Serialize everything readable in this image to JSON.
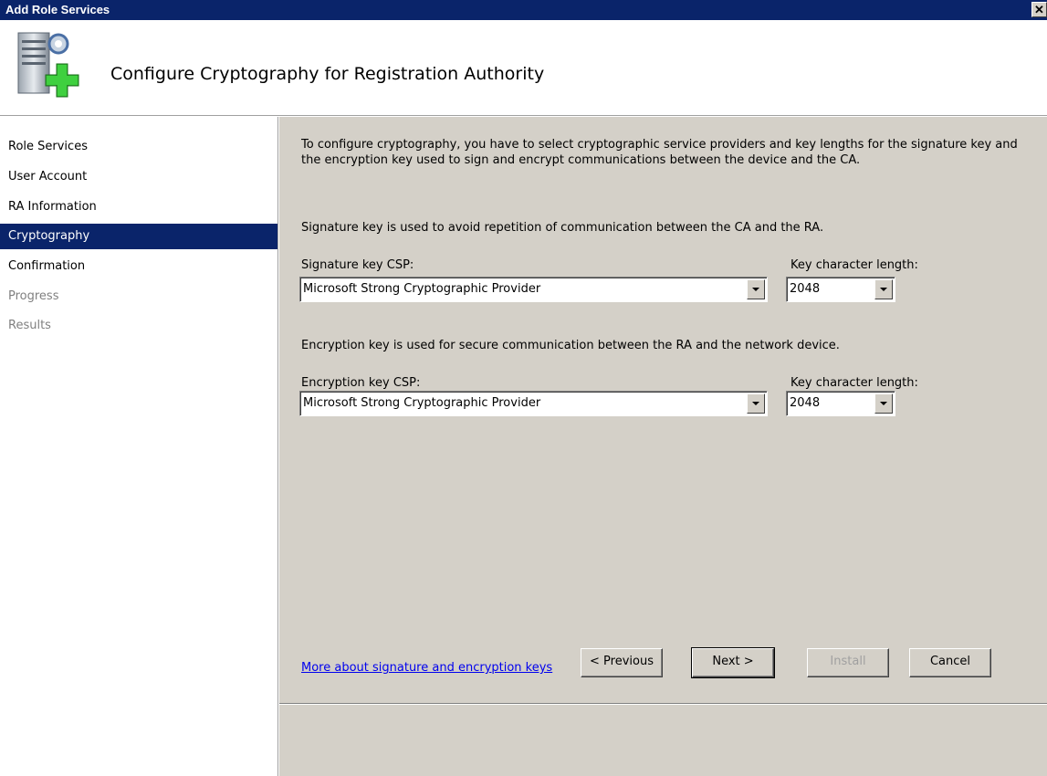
{
  "window": {
    "title": "Add Role Services",
    "close_glyph": "✕"
  },
  "header": {
    "title": "Configure Cryptography for Registration Authority",
    "icon": "server-add-icon"
  },
  "sidebar": {
    "items": [
      {
        "label": "Role Services",
        "state": "normal"
      },
      {
        "label": "User Account",
        "state": "normal"
      },
      {
        "label": "RA Information",
        "state": "normal"
      },
      {
        "label": "Cryptography",
        "state": "active"
      },
      {
        "label": "Confirmation",
        "state": "normal"
      },
      {
        "label": "Progress",
        "state": "disabled"
      },
      {
        "label": "Results",
        "state": "disabled"
      }
    ]
  },
  "main": {
    "intro": "To configure cryptography, you have to select cryptographic service providers and key lengths for the signature key and the encryption key used to sign and encrypt communications between the device and the CA.",
    "signature": {
      "description": "Signature key is used to avoid repetition of communication between the CA and the RA.",
      "csp_label": "Signature key CSP:",
      "csp_value": "Microsoft Strong Cryptographic Provider",
      "length_label": "Key character length:",
      "length_value": "2048"
    },
    "encryption": {
      "description": "Encryption key is used for secure communication between the RA and the network device.",
      "csp_label": "Encryption key CSP:",
      "csp_value": "Microsoft Strong Cryptographic Provider",
      "length_label": "Key character length:",
      "length_value": "2048"
    },
    "link": "More about signature and encryption keys"
  },
  "buttons": {
    "previous": "< Previous",
    "next": "Next >",
    "install": "Install",
    "cancel": "Cancel"
  },
  "colors": {
    "titlebar": "#0a246a",
    "panel": "#d4d0c8",
    "link": "#0000ee"
  }
}
